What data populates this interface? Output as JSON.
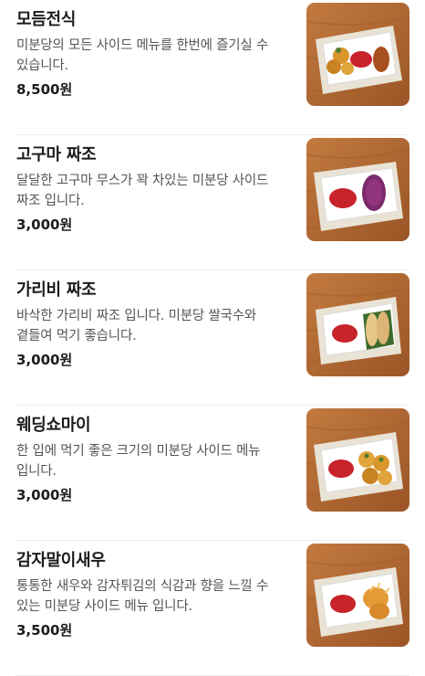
{
  "menu": {
    "items": [
      {
        "name": "모듬전식",
        "description": "미분당의 모든 사이드 메뉴를 한번에 즐기실 수 있습니다.",
        "price": "8,500원",
        "image_alt": "모듬전식 사진",
        "image_icon": "assorted-fried-platter-photo"
      },
      {
        "name": "고구마 짜조",
        "description": "달달한 고구마 무스가 꽉 차있는 미분당 사이드 짜조 입니다.",
        "price": "3,000원",
        "image_alt": "고구마 짜조 사진",
        "image_icon": "sweet-potato-spring-roll-photo"
      },
      {
        "name": "가리비 짜조",
        "description": "바삭한 가리비 짜조 입니다. 미분당 쌀국수와 곁들여 먹기 좋습니다.",
        "price": "3,000원",
        "image_alt": "가리비 짜조 사진",
        "image_icon": "scallop-spring-roll-photo"
      },
      {
        "name": "웨딩쇼마이",
        "description": "한 입에 먹기 좋은 크기의 미분당 사이드 메뉴 입니다.",
        "price": "3,000원",
        "image_alt": "웨딩쇼마이 사진",
        "image_icon": "wedding-shumai-photo"
      },
      {
        "name": "감자말이새우",
        "description": "통통한 새우와 감자튀김의 식감과 향을 느낄 수 있는 미분당 사이드 메뉴 입니다.",
        "price": "3,500원",
        "image_alt": "감자말이새우 사진",
        "image_icon": "potato-wrapped-shrimp-photo"
      }
    ]
  },
  "colors": {
    "text_primary": "#1c1c1c",
    "text_secondary": "#555555",
    "divider": "#ededed",
    "wood": "#b46a35",
    "sauce": "#c8222a"
  }
}
